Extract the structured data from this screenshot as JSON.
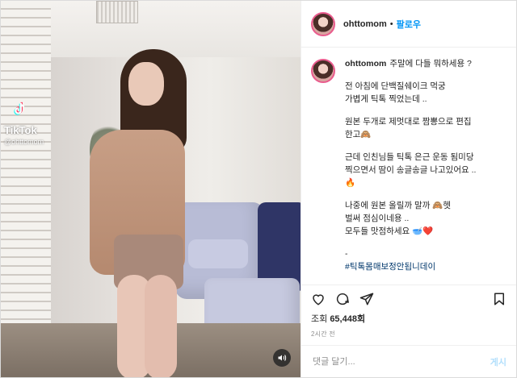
{
  "tiktok": {
    "label": "TikTok",
    "handle": "@ohttomom"
  },
  "header": {
    "username": "ohttomom",
    "dot": "•",
    "follow": "팔로우"
  },
  "caption": {
    "username": "ohttomom",
    "first": "주말에 다들 뭐하세용 ?",
    "paragraphs": [
      "전 아침에 단백질쉐이크 먹궁\n가볍게 틱톡 찍었는데 ..",
      "원본 두개로 제멋대로 짬뽕으로 편집\n한고🙈",
      "근데 인친님들 틱톡 은근 운동 됨미당\n찍으면서 땀이 송글송글 나고있어요 ..\n🔥",
      "나중에 원본 올릴까 말까 🙈헷\n벌써 점심이네용 ..\n모두들 맛점하세요 🥣❤️",
      "-"
    ],
    "hashtag": "#틱톡몸매보정안됩니데이"
  },
  "stats": {
    "views_prefix": "조회",
    "views": "65,448회",
    "time": "2시간 전"
  },
  "comment": {
    "placeholder": "댓글 달기...",
    "post": "게시"
  },
  "icons": {
    "heart": "heart-icon",
    "comment": "comment-icon",
    "share": "share-icon",
    "save": "bookmark-icon",
    "sound": "speaker-icon",
    "tiktok": "tiktok-icon"
  },
  "colors": {
    "follow": "#0095f6",
    "hashtag": "#00376b"
  }
}
